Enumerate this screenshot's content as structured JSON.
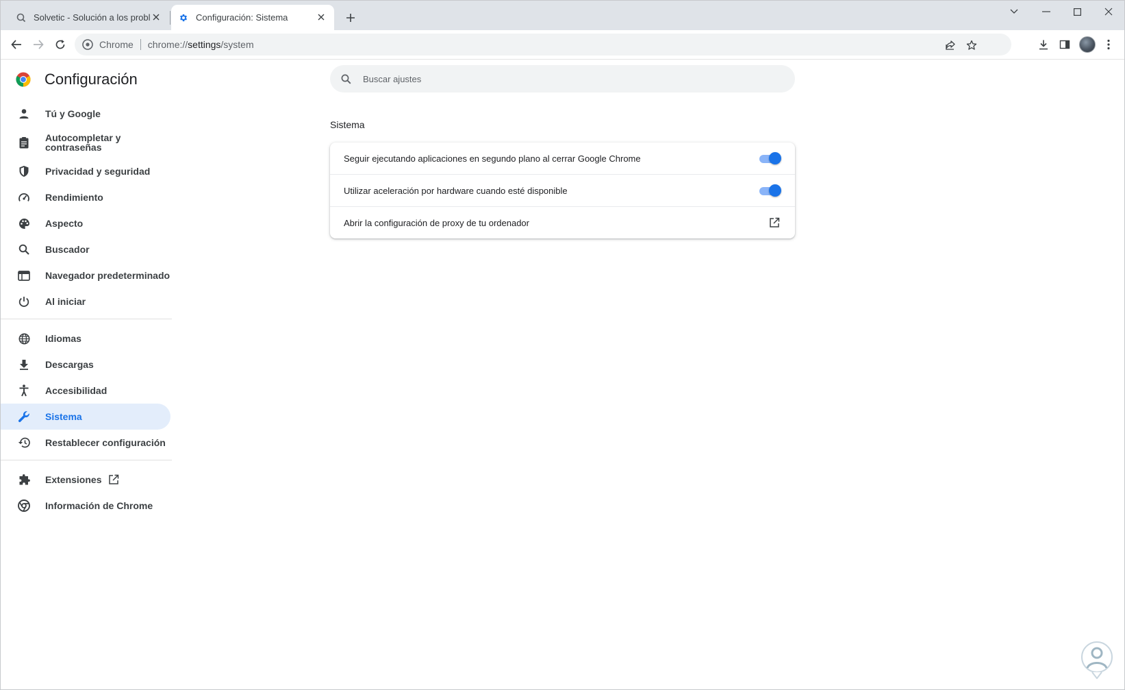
{
  "browser": {
    "tabs": [
      {
        "title": "Solvetic - Solución a los problem",
        "active": false,
        "favicon": "solvetic-icon"
      },
      {
        "title": "Configuración: Sistema",
        "active": true,
        "favicon": "gear-icon"
      }
    ],
    "omnibox": {
      "site_name": "Chrome",
      "url_prefix": "chrome://",
      "url_host": "settings",
      "url_path": "/system"
    }
  },
  "settings": {
    "title": "Configuración",
    "search_placeholder": "Buscar ajustes",
    "nav": [
      {
        "label": "Tú y Google",
        "icon": "person-icon"
      },
      {
        "label": "Autocompletar y contraseñas",
        "icon": "clipboard-icon"
      },
      {
        "label": "Privacidad y seguridad",
        "icon": "shield-icon"
      },
      {
        "label": "Rendimiento",
        "icon": "speedometer-icon"
      },
      {
        "label": "Aspecto",
        "icon": "palette-icon"
      },
      {
        "label": "Buscador",
        "icon": "search-icon"
      },
      {
        "label": "Navegador predeterminado",
        "icon": "browser-icon"
      },
      {
        "label": "Al iniciar",
        "icon": "power-icon"
      },
      {
        "label": "Idiomas",
        "icon": "globe-icon"
      },
      {
        "label": "Descargas",
        "icon": "download-icon"
      },
      {
        "label": "Accesibilidad",
        "icon": "accessibility-icon"
      },
      {
        "label": "Sistema",
        "icon": "wrench-icon",
        "selected": true
      },
      {
        "label": "Restablecer configuración",
        "icon": "restore-icon"
      },
      {
        "label": "Extensiones",
        "icon": "puzzle-icon"
      },
      {
        "label": "Información de Chrome",
        "icon": "chrome-icon"
      }
    ],
    "section_title": "Sistema",
    "rows": [
      {
        "label": "Seguir ejecutando aplicaciones en segundo plano al cerrar Google Chrome",
        "control": "toggle",
        "on": true
      },
      {
        "label": "Utilizar aceleración por hardware cuando esté disponible",
        "control": "toggle",
        "on": true
      },
      {
        "label": "Abrir la configuración de proxy de tu ordenador",
        "control": "external-link"
      }
    ]
  },
  "colors": {
    "accent": "#1a73e8",
    "selected_nav_bg": "#e3edfb",
    "tabstrip": "#dfe3e8"
  }
}
